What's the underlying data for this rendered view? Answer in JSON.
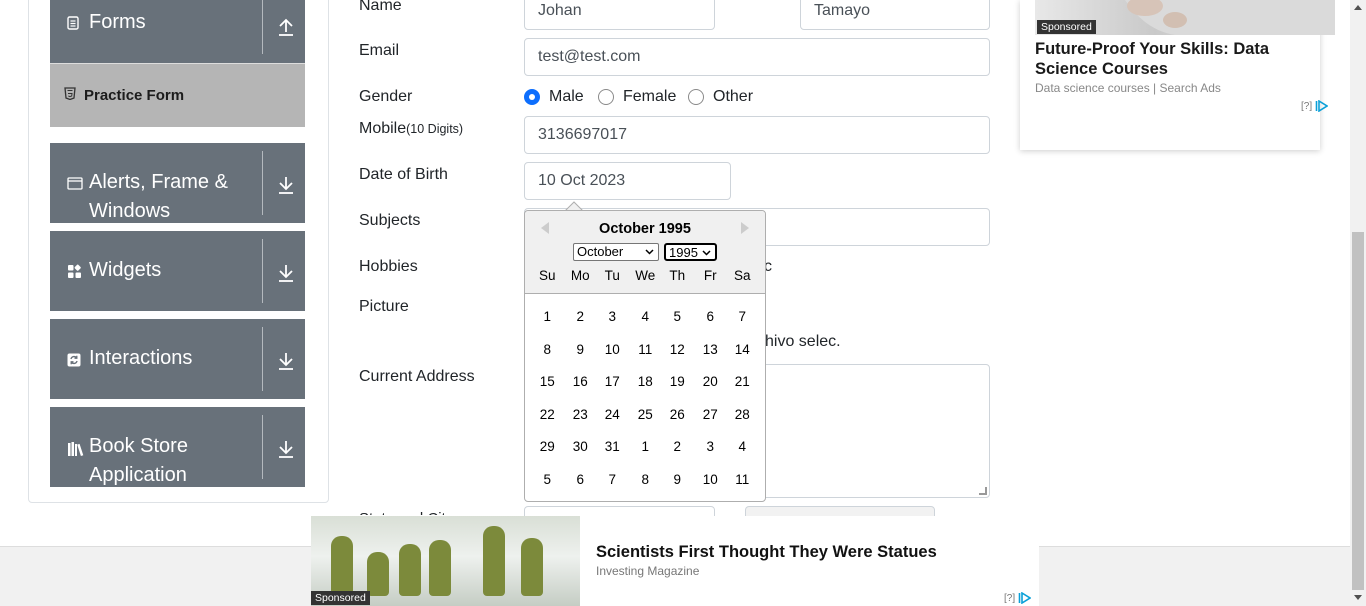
{
  "sidebar": {
    "groups": [
      {
        "label": "Forms",
        "icon": "document-icon",
        "arrow": "up"
      },
      {
        "label": "Alerts, Frame &",
        "label2": "Windows",
        "icon": "window-icon",
        "arrow": "down"
      },
      {
        "label": "Widgets",
        "icon": "widgets-icon",
        "arrow": "down"
      },
      {
        "label": "Interactions",
        "icon": "refresh-icon",
        "arrow": "down"
      },
      {
        "label": "Book Store",
        "label2": "Application",
        "icon": "books-icon",
        "arrow": "down"
      }
    ],
    "active_item": "Practice Form"
  },
  "form": {
    "name_label": "Name",
    "first_name": "Johan",
    "last_name": "Tamayo",
    "email_label": "Email",
    "email": "test@test.com",
    "gender_label": "Gender",
    "gender_options": [
      "Male",
      "Female",
      "Other"
    ],
    "gender_selected": "Male",
    "mobile_label": "Mobile",
    "mobile_hint": "(10 Digits)",
    "mobile": "3136697017",
    "dob_label": "Date of Birth",
    "dob": "10 Oct 2023",
    "subjects_label": "Subjects",
    "hobbies_label": "Hobbies",
    "hobbies_partial": "c",
    "picture_label": "Picture",
    "file_status_partial": "hivo selec.",
    "address_label": "Current Address",
    "state_city_partial": "State and Cit"
  },
  "datepicker": {
    "title": "October 1995",
    "month_select": "October",
    "year_select": "1995",
    "weekdays": [
      "Su",
      "Mo",
      "Tu",
      "We",
      "Th",
      "Fr",
      "Sa"
    ],
    "weeks": [
      [
        "1",
        "2",
        "3",
        "4",
        "5",
        "6",
        "7"
      ],
      [
        "8",
        "9",
        "10",
        "11",
        "12",
        "13",
        "14"
      ],
      [
        "15",
        "16",
        "17",
        "18",
        "19",
        "20",
        "21"
      ],
      [
        "22",
        "23",
        "24",
        "25",
        "26",
        "27",
        "28"
      ],
      [
        "29",
        "30",
        "31",
        "1",
        "2",
        "3",
        "4"
      ],
      [
        "5",
        "6",
        "7",
        "8",
        "9",
        "10",
        "11"
      ]
    ]
  },
  "ads": {
    "right": {
      "tag": "Sponsored",
      "title": "Future-Proof Your Skills: Data Science Courses",
      "source": "Data science courses | Search Ads",
      "choice": "[?]"
    },
    "bottom": {
      "tag": "Sponsored",
      "title": "Scientists First Thought They Were Statues",
      "source": "Investing Magazine",
      "choice": "[?]"
    }
  },
  "colors": {
    "sidebar_group": "#68717a",
    "active_item": "#b5b5b5",
    "accent": "#0d6efd"
  }
}
